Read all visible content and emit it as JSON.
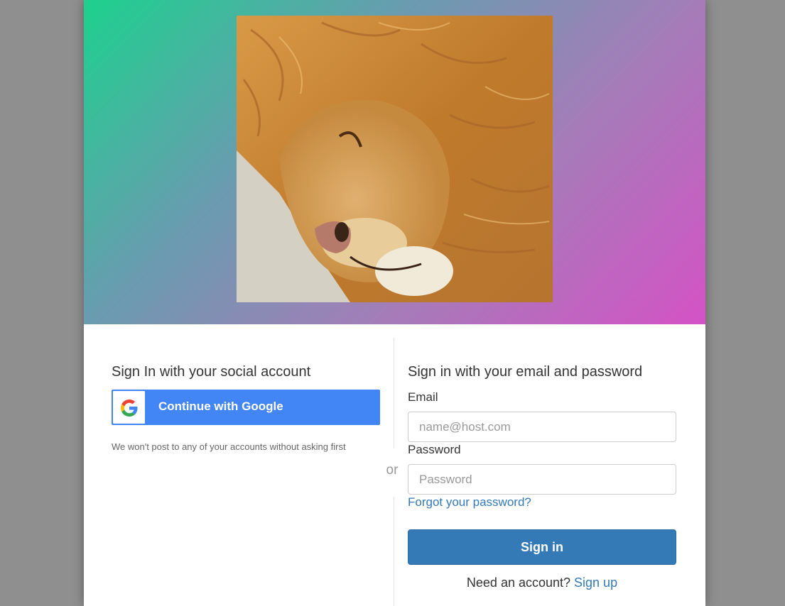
{
  "banner": {
    "logo_image": "sleeping-lion-photo",
    "gradient_colors": [
      "#1dd18e",
      "#6a9bb0",
      "#a47db8",
      "#d452c6"
    ]
  },
  "social": {
    "heading": "Sign In with your social account",
    "google_button_label": "Continue with Google",
    "google_icon": "google-g-icon",
    "disclaimer": "We won't post to any of your accounts without asking first"
  },
  "divider": {
    "or_text": "or"
  },
  "email_form": {
    "heading": "Sign in with your email and password",
    "email_label": "Email",
    "email_placeholder": "name@host.com",
    "email_value": "",
    "password_label": "Password",
    "password_placeholder": "Password",
    "password_value": "",
    "forgot_link": "Forgot your password?",
    "submit_label": "Sign in",
    "signup_prompt": "Need an account?",
    "signup_link": "Sign up"
  },
  "colors": {
    "google_blue": "#4285f4",
    "primary_button": "#337ab7",
    "link": "#337ab7"
  }
}
